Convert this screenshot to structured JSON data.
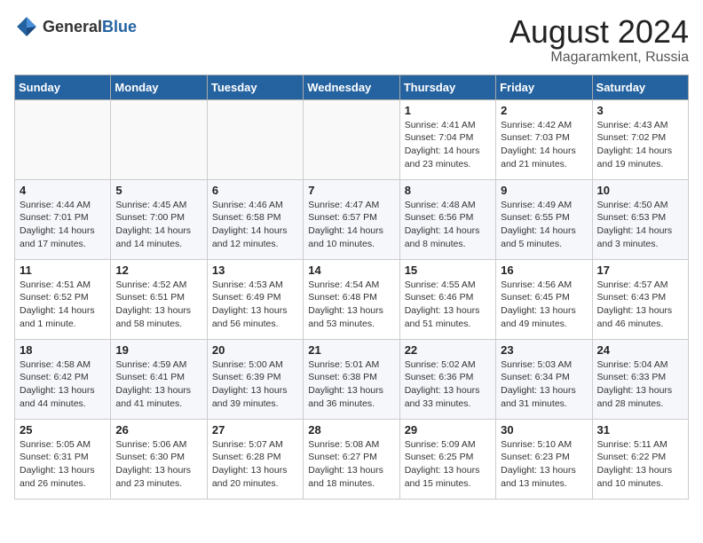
{
  "header": {
    "logo_general": "General",
    "logo_blue": "Blue",
    "title": "August 2024",
    "subtitle": "Magaramkent, Russia"
  },
  "weekdays": [
    "Sunday",
    "Monday",
    "Tuesday",
    "Wednesday",
    "Thursday",
    "Friday",
    "Saturday"
  ],
  "weeks": [
    [
      {
        "day": "",
        "info": ""
      },
      {
        "day": "",
        "info": ""
      },
      {
        "day": "",
        "info": ""
      },
      {
        "day": "",
        "info": ""
      },
      {
        "day": "1",
        "info": "Sunrise: 4:41 AM\nSunset: 7:04 PM\nDaylight: 14 hours\nand 23 minutes."
      },
      {
        "day": "2",
        "info": "Sunrise: 4:42 AM\nSunset: 7:03 PM\nDaylight: 14 hours\nand 21 minutes."
      },
      {
        "day": "3",
        "info": "Sunrise: 4:43 AM\nSunset: 7:02 PM\nDaylight: 14 hours\nand 19 minutes."
      }
    ],
    [
      {
        "day": "4",
        "info": "Sunrise: 4:44 AM\nSunset: 7:01 PM\nDaylight: 14 hours\nand 17 minutes."
      },
      {
        "day": "5",
        "info": "Sunrise: 4:45 AM\nSunset: 7:00 PM\nDaylight: 14 hours\nand 14 minutes."
      },
      {
        "day": "6",
        "info": "Sunrise: 4:46 AM\nSunset: 6:58 PM\nDaylight: 14 hours\nand 12 minutes."
      },
      {
        "day": "7",
        "info": "Sunrise: 4:47 AM\nSunset: 6:57 PM\nDaylight: 14 hours\nand 10 minutes."
      },
      {
        "day": "8",
        "info": "Sunrise: 4:48 AM\nSunset: 6:56 PM\nDaylight: 14 hours\nand 8 minutes."
      },
      {
        "day": "9",
        "info": "Sunrise: 4:49 AM\nSunset: 6:55 PM\nDaylight: 14 hours\nand 5 minutes."
      },
      {
        "day": "10",
        "info": "Sunrise: 4:50 AM\nSunset: 6:53 PM\nDaylight: 14 hours\nand 3 minutes."
      }
    ],
    [
      {
        "day": "11",
        "info": "Sunrise: 4:51 AM\nSunset: 6:52 PM\nDaylight: 14 hours\nand 1 minute."
      },
      {
        "day": "12",
        "info": "Sunrise: 4:52 AM\nSunset: 6:51 PM\nDaylight: 13 hours\nand 58 minutes."
      },
      {
        "day": "13",
        "info": "Sunrise: 4:53 AM\nSunset: 6:49 PM\nDaylight: 13 hours\nand 56 minutes."
      },
      {
        "day": "14",
        "info": "Sunrise: 4:54 AM\nSunset: 6:48 PM\nDaylight: 13 hours\nand 53 minutes."
      },
      {
        "day": "15",
        "info": "Sunrise: 4:55 AM\nSunset: 6:46 PM\nDaylight: 13 hours\nand 51 minutes."
      },
      {
        "day": "16",
        "info": "Sunrise: 4:56 AM\nSunset: 6:45 PM\nDaylight: 13 hours\nand 49 minutes."
      },
      {
        "day": "17",
        "info": "Sunrise: 4:57 AM\nSunset: 6:43 PM\nDaylight: 13 hours\nand 46 minutes."
      }
    ],
    [
      {
        "day": "18",
        "info": "Sunrise: 4:58 AM\nSunset: 6:42 PM\nDaylight: 13 hours\nand 44 minutes."
      },
      {
        "day": "19",
        "info": "Sunrise: 4:59 AM\nSunset: 6:41 PM\nDaylight: 13 hours\nand 41 minutes."
      },
      {
        "day": "20",
        "info": "Sunrise: 5:00 AM\nSunset: 6:39 PM\nDaylight: 13 hours\nand 39 minutes."
      },
      {
        "day": "21",
        "info": "Sunrise: 5:01 AM\nSunset: 6:38 PM\nDaylight: 13 hours\nand 36 minutes."
      },
      {
        "day": "22",
        "info": "Sunrise: 5:02 AM\nSunset: 6:36 PM\nDaylight: 13 hours\nand 33 minutes."
      },
      {
        "day": "23",
        "info": "Sunrise: 5:03 AM\nSunset: 6:34 PM\nDaylight: 13 hours\nand 31 minutes."
      },
      {
        "day": "24",
        "info": "Sunrise: 5:04 AM\nSunset: 6:33 PM\nDaylight: 13 hours\nand 28 minutes."
      }
    ],
    [
      {
        "day": "25",
        "info": "Sunrise: 5:05 AM\nSunset: 6:31 PM\nDaylight: 13 hours\nand 26 minutes."
      },
      {
        "day": "26",
        "info": "Sunrise: 5:06 AM\nSunset: 6:30 PM\nDaylight: 13 hours\nand 23 minutes."
      },
      {
        "day": "27",
        "info": "Sunrise: 5:07 AM\nSunset: 6:28 PM\nDaylight: 13 hours\nand 20 minutes."
      },
      {
        "day": "28",
        "info": "Sunrise: 5:08 AM\nSunset: 6:27 PM\nDaylight: 13 hours\nand 18 minutes."
      },
      {
        "day": "29",
        "info": "Sunrise: 5:09 AM\nSunset: 6:25 PM\nDaylight: 13 hours\nand 15 minutes."
      },
      {
        "day": "30",
        "info": "Sunrise: 5:10 AM\nSunset: 6:23 PM\nDaylight: 13 hours\nand 13 minutes."
      },
      {
        "day": "31",
        "info": "Sunrise: 5:11 AM\nSunset: 6:22 PM\nDaylight: 13 hours\nand 10 minutes."
      }
    ]
  ]
}
